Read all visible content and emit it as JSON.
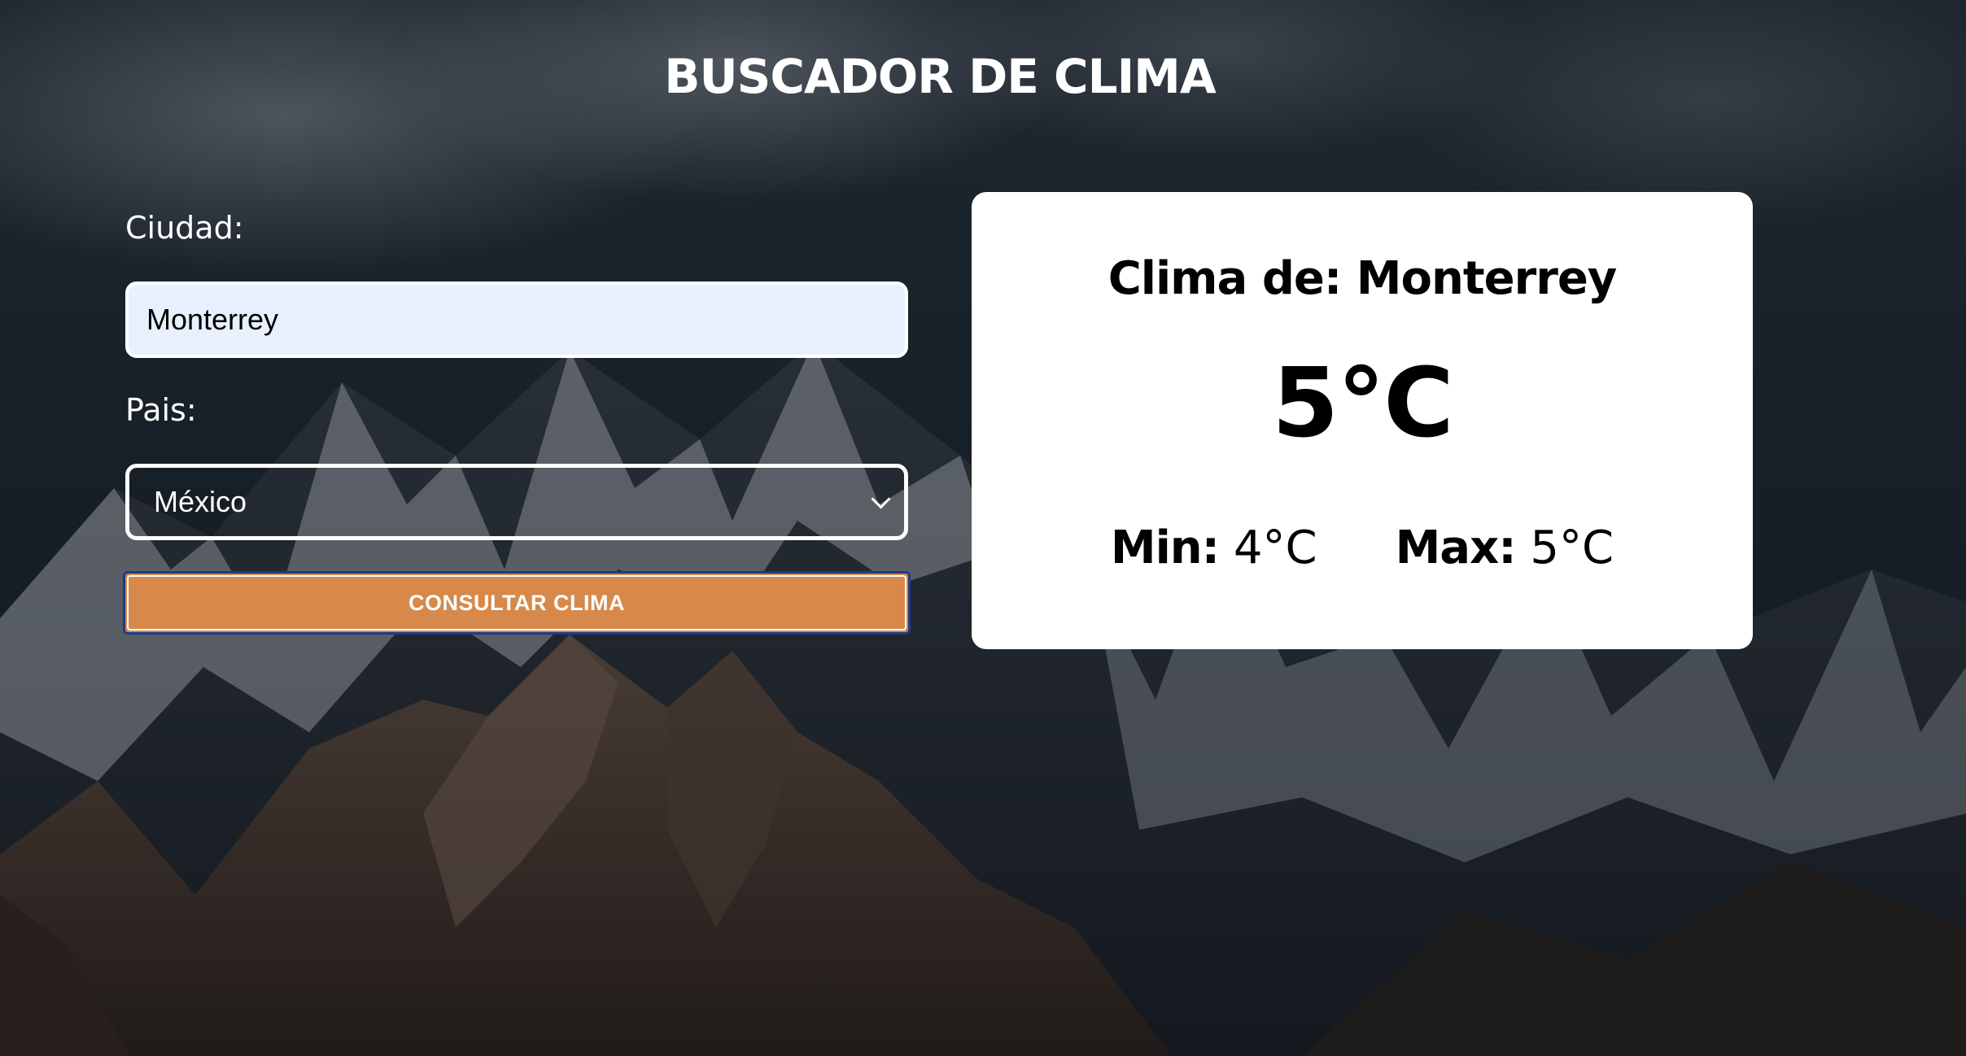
{
  "header": {
    "title": "BUSCADOR DE CLIMA"
  },
  "form": {
    "city_label": "Ciudad:",
    "city_value": "Monterrey",
    "country_label": "Pais:",
    "country_selected": "México",
    "submit_label": "CONSULTAR CLIMA"
  },
  "result": {
    "title": "Clima de: Monterrey",
    "temperature": "5°C",
    "min_label": "Min:",
    "min_value": "4°C",
    "max_label": "Max:",
    "max_value": "5°C"
  },
  "colors": {
    "button_bg": "#d6894a",
    "input_bg": "#e8f0fe",
    "card_bg": "#ffffff",
    "button_focus_border": "#1f3a8a"
  },
  "icons": {
    "select_chevron": "chevron-down-icon"
  }
}
